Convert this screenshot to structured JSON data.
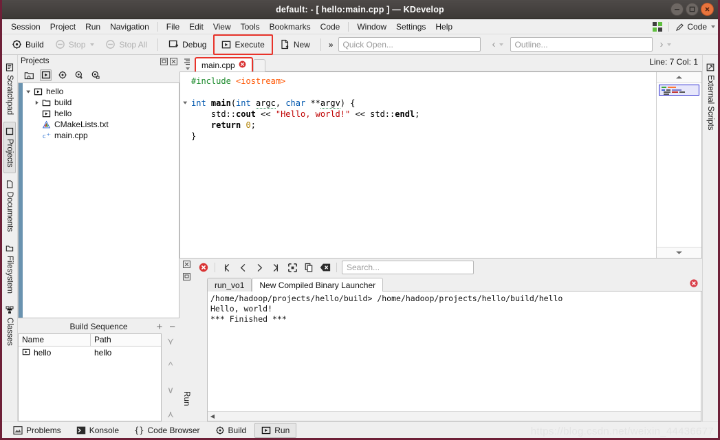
{
  "window": {
    "title": "default:  - [ hello:main.cpp ] — KDevelop",
    "buttons": {
      "minimize": "minimize-icon",
      "maximize": "maximize-icon",
      "close": "close-icon"
    }
  },
  "menubar": {
    "groups": [
      [
        "Session",
        "Project",
        "Run",
        "Navigation"
      ],
      [
        "File",
        "Edit",
        "View",
        "Tools",
        "Bookmarks",
        "Code"
      ],
      [
        "Window",
        "Settings",
        "Help"
      ]
    ],
    "right": {
      "grid_icon": "window-grid-icon",
      "mode_label": "Code",
      "mode_icon": "pencil-icon"
    }
  },
  "toolbar": {
    "build": "Build",
    "stop": "Stop",
    "stop_all": "Stop All",
    "debug": "Debug",
    "execute": "Execute",
    "new": "New",
    "overflow": "»",
    "quick_open_placeholder": "Quick Open...",
    "outline_placeholder": "Outline...",
    "highlight_color": "#e8332a"
  },
  "left_tabs": [
    {
      "label": "Scratchpad",
      "icon": "scratchpad-icon",
      "active": false
    },
    {
      "label": "Projects",
      "icon": "projects-icon",
      "active": true
    },
    {
      "label": "Documents",
      "icon": "documents-icon",
      "active": false
    },
    {
      "label": "Filesystem",
      "icon": "filesystem-icon",
      "active": false
    },
    {
      "label": "Classes",
      "icon": "classes-icon",
      "active": false
    }
  ],
  "right_tabs": [
    {
      "label": "External Scripts",
      "icon": "external-scripts-icon",
      "active": false
    }
  ],
  "projects_panel": {
    "title": "Projects",
    "header_actions": [
      "undock-icon",
      "close-icon"
    ],
    "toolbar_icons": [
      "open-project-icon",
      "project-selection-icon",
      "build-config-icon",
      "build-install-icon",
      "build-options-icon"
    ],
    "tree": [
      {
        "indent": 0,
        "arrow": "expanded",
        "icon": "project-icon",
        "label": "hello"
      },
      {
        "indent": 1,
        "arrow": "collapsed",
        "icon": "folder-icon",
        "label": "build"
      },
      {
        "indent": 1,
        "arrow": "none",
        "icon": "target-icon",
        "label": "hello"
      },
      {
        "indent": 1,
        "arrow": "none",
        "icon": "cmake-icon",
        "label": "CMakeLists.txt"
      },
      {
        "indent": 1,
        "arrow": "none",
        "icon": "cpp-file-icon",
        "label": "main.cpp"
      }
    ]
  },
  "build_sequence": {
    "title": "Build Sequence",
    "add_label": "+",
    "remove_label": "−",
    "columns": [
      "Name",
      "Path"
    ],
    "rows": [
      {
        "icon": "target-icon",
        "name": "hello",
        "path": "hello"
      }
    ],
    "side_buttons": [
      "move-top-icon",
      "move-up-icon",
      "move-down-icon",
      "move-bottom-icon"
    ]
  },
  "editor": {
    "tabs_menu_icon": "tab-list-icon",
    "tab": {
      "label": "main.cpp",
      "close_icon": "close-tab-icon",
      "modified": false
    },
    "status": "Line: 7 Col: 1",
    "lines": [
      {
        "fold": false,
        "tokens": [
          {
            "t": "#include ",
            "c": "pre"
          },
          {
            "t": "<iostream>",
            "c": "inc"
          }
        ]
      },
      {
        "fold": false,
        "tokens": []
      },
      {
        "fold": true,
        "tokens": [
          {
            "t": "int ",
            "c": "kw"
          },
          {
            "t": "main",
            "c": "fn"
          },
          {
            "t": "(",
            "c": "op"
          },
          {
            "t": "int ",
            "c": "kw"
          },
          {
            "t": "argc",
            "c": "var"
          },
          {
            "t": ", ",
            "c": "op"
          },
          {
            "t": "char ",
            "c": "kw"
          },
          {
            "t": "**",
            "c": "op"
          },
          {
            "t": "argv",
            "c": "var"
          },
          {
            "t": ") {",
            "c": "op"
          }
        ]
      },
      {
        "fold": false,
        "tokens": [
          {
            "t": "    std::",
            "c": "op"
          },
          {
            "t": "cout",
            "c": "kwb"
          },
          {
            "t": " << ",
            "c": "op"
          },
          {
            "t": "\"Hello, world!\"",
            "c": "str"
          },
          {
            "t": " << std::",
            "c": "op"
          },
          {
            "t": "endl",
            "c": "kwb"
          },
          {
            "t": ";",
            "c": "op"
          }
        ]
      },
      {
        "fold": false,
        "tokens": [
          {
            "t": "    ",
            "c": "op"
          },
          {
            "t": "return ",
            "c": "kwb"
          },
          {
            "t": "0",
            "c": "num"
          },
          {
            "t": ";",
            "c": "op"
          }
        ]
      },
      {
        "fold": false,
        "tokens": [
          {
            "t": "}",
            "c": "op"
          }
        ]
      }
    ],
    "minimap": {
      "up_icon": "scroll-up-icon",
      "down_icon": "scroll-down-icon",
      "thumb": "viewport-thumb"
    }
  },
  "output_panel": {
    "left_icons": [
      "close-panel-icon",
      "undock-panel-icon"
    ],
    "vertical_label": "Run",
    "toolbar_icons": [
      "cancel-icon",
      "first-item-icon",
      "previous-item-icon",
      "next-item-icon",
      "last-item-icon",
      "select-all-icon",
      "copy-icon",
      "clear-icon"
    ],
    "search_placeholder": "Search...",
    "tabs": [
      {
        "label": "run_vo1",
        "active": false
      },
      {
        "label": "New Compiled Binary Launcher",
        "active": true
      }
    ],
    "tab_close_icon": "close-output-icon",
    "lines": [
      "/home/hadoop/projects/hello/build> /home/hadoop/projects/hello/build/hello",
      "Hello, world!",
      "*** Finished ***"
    ],
    "hscroll": {
      "left_arrow": "◀",
      "right_arrow": "▶"
    }
  },
  "statusbar": {
    "items": [
      {
        "label": "Problems",
        "icon": "problems-icon",
        "active": false
      },
      {
        "label": "Konsole",
        "icon": "konsole-icon",
        "active": false
      },
      {
        "label": "Code Browser",
        "icon": "code-browser-icon",
        "active": false
      },
      {
        "label": "Build",
        "icon": "build-icon",
        "active": false
      },
      {
        "label": "Run",
        "icon": "run-icon",
        "active": true
      }
    ]
  },
  "watermark": "https://blog.csdn.net/weixin_44436677"
}
